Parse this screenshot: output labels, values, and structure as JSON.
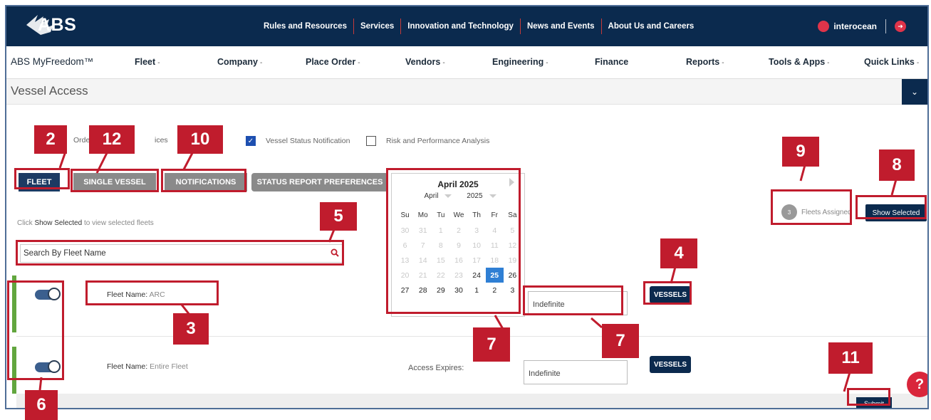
{
  "topbar": {
    "logo": "ABS",
    "nav": [
      "Rules and Resources",
      "Services",
      "Innovation and Technology",
      "News and Events",
      "About Us and Careers"
    ],
    "username": "interocean"
  },
  "menubar": {
    "brand": "ABS MyFreedom™",
    "items": [
      {
        "label": "Fleet",
        "caret": "-"
      },
      {
        "label": "Company",
        "caret": "-"
      },
      {
        "label": "Place Order",
        "caret": "-"
      },
      {
        "label": "Vendors",
        "caret": "-"
      },
      {
        "label": "Engineering",
        "caret": "-"
      },
      {
        "label": "Finance",
        "caret": ""
      },
      {
        "label": "Reports",
        "caret": "-"
      },
      {
        "label": "Tools & Apps",
        "caret": "-"
      },
      {
        "label": "Quick Links",
        "caret": "-"
      }
    ]
  },
  "page": {
    "title": "Vessel Access",
    "check_partial_1": "Orde",
    "check_partial_2": "ices",
    "check_vessel_status": "Vessel Status Notification",
    "check_risk": "Risk and Performance Analysis",
    "vessel_status_checked": true,
    "risk_checked": false
  },
  "tabs": {
    "fleet": "FLEET",
    "single_vessel": "SINGLE VESSEL",
    "notifications": "NOTIFICATIONS",
    "status_report": "STATUS REPORT PREFERENCES"
  },
  "hint": {
    "prefix": "Click ",
    "bold": "Show Selected",
    "suffix": " to view selected fleets"
  },
  "search": {
    "placeholder": "Search By Fleet Name"
  },
  "fleets": [
    {
      "label": "Fleet Name:",
      "value": "ARC",
      "expires_label": "",
      "expires": "Indefinite",
      "button": "VESSELS"
    },
    {
      "label": "Fleet Name:",
      "value": "Entire Fleet",
      "expires_label": "Access Expires:",
      "expires": "Indefinite",
      "button": "VESSELS"
    }
  ],
  "calendar": {
    "title": "April 2025",
    "month_select": "April",
    "year_select": "2025",
    "weekdays": [
      "Su",
      "Mo",
      "Tu",
      "We",
      "Th",
      "Fr",
      "Sa"
    ],
    "weeks": [
      [
        "30",
        "31",
        "1",
        "2",
        "3",
        "4",
        "5"
      ],
      [
        "6",
        "7",
        "8",
        "9",
        "10",
        "11",
        "12"
      ],
      [
        "13",
        "14",
        "15",
        "16",
        "17",
        "18",
        "19"
      ],
      [
        "20",
        "21",
        "22",
        "23",
        "24",
        "25",
        "26"
      ],
      [
        "27",
        "28",
        "29",
        "30",
        "1",
        "2",
        "3"
      ]
    ],
    "today": "25"
  },
  "assigned": {
    "count": "3",
    "label": "Fleets Assigned"
  },
  "buttons": {
    "show_selected": "Show Selected",
    "submit": "Submit",
    "help": "?"
  },
  "annotations": [
    "2",
    "12",
    "10",
    "9",
    "8",
    "5",
    "4",
    "3",
    "7",
    "7",
    "11",
    "6"
  ],
  "colors": {
    "navy": "#0b2a4e",
    "annotation_red": "#c01c2d",
    "toggle_on": "#3b5f8e",
    "row_green": "#62a63e"
  }
}
